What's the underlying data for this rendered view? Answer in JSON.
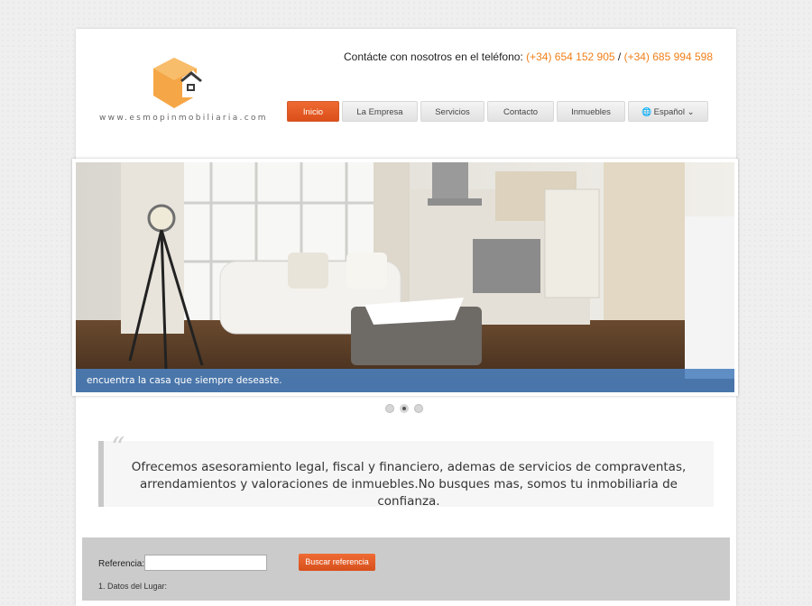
{
  "logo": {
    "domain": "www.esmopinmobiliaria.com"
  },
  "contact": {
    "prefix": "Contácte con nosotros en el teléfono:",
    "phone1": "(+34) 654 152 905",
    "separator": "/",
    "phone2": "(+34) 685 994 598"
  },
  "nav": {
    "items": [
      "Inicio",
      "La Empresa",
      "Servicios",
      "Contacto",
      "Inmuebles"
    ],
    "language": "Español",
    "active_index": 0
  },
  "slider": {
    "caption": "encuentra la casa que siempre deseaste.",
    "slide_count": 3,
    "active_slide": 2
  },
  "quote": {
    "text": "Ofrecemos asesoramiento legal, fiscal y financiero, ademas de servicios de compraventas, arrendamientos y valoraciones de inmuebles.No busques mas, somos tu inmobiliaria de confianza."
  },
  "search": {
    "label": "Referencia:",
    "value": "",
    "button": "Buscar referencia",
    "sub": "1. Datos del Lugar:"
  },
  "colors": {
    "accent": "#e35b24",
    "phone": "#f07f1a",
    "caption": "#4a80be"
  }
}
